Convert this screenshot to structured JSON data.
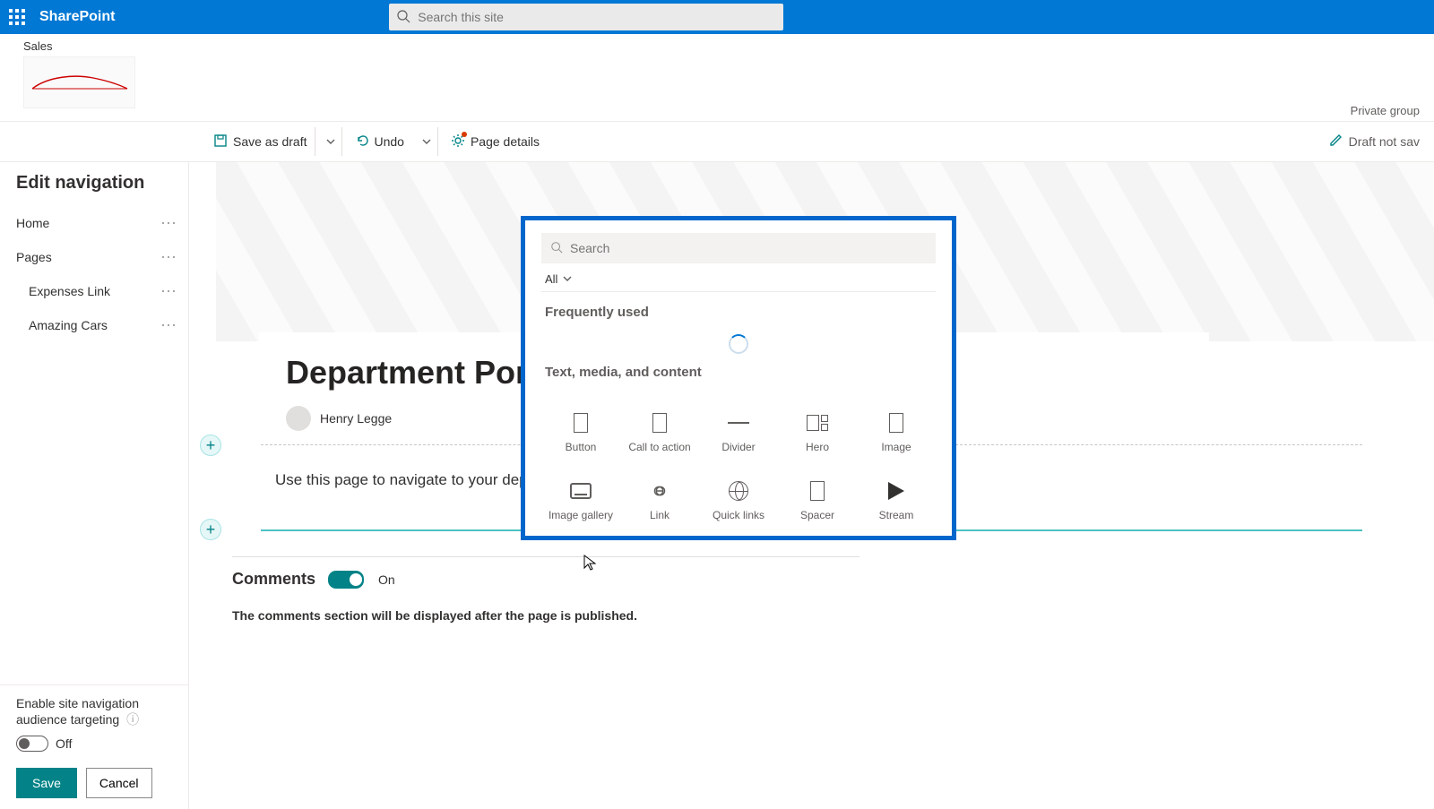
{
  "suite": {
    "brand": "SharePoint",
    "search_placeholder": "Search this site"
  },
  "site": {
    "title": "Sales",
    "privacy": "Private group"
  },
  "commands": {
    "save_draft": "Save as draft",
    "undo": "Undo",
    "page_details": "Page details",
    "draft_status": "Draft not sav"
  },
  "nav": {
    "title": "Edit navigation",
    "items": [
      {
        "label": "Home",
        "sub": false
      },
      {
        "label": "Pages",
        "sub": false
      },
      {
        "label": "Expenses Link",
        "sub": true
      },
      {
        "label": "Amazing Cars",
        "sub": true
      }
    ],
    "targeting_label": "Enable site navigation audience targeting",
    "targeting_state": "Off",
    "save": "Save",
    "cancel": "Cancel"
  },
  "page": {
    "title": "Department Portals",
    "author": "Henry Legge",
    "intro": "Use this page to navigate to your department portals"
  },
  "comments": {
    "label": "Comments",
    "state": "On",
    "note": "The comments section will be displayed after the page is published."
  },
  "picker": {
    "search_placeholder": "Search",
    "filter": "All",
    "section_freq": "Frequently used",
    "section_text": "Text, media, and content",
    "items1": [
      {
        "label": "Button",
        "icon": "box"
      },
      {
        "label": "Call to action",
        "icon": "box"
      },
      {
        "label": "Divider",
        "icon": "hline"
      },
      {
        "label": "Hero",
        "icon": "hero"
      },
      {
        "label": "Image",
        "icon": "box"
      }
    ],
    "items2": [
      {
        "label": "Image gallery",
        "icon": "gallery"
      },
      {
        "label": "Link",
        "icon": "link"
      },
      {
        "label": "Quick links",
        "icon": "globe"
      },
      {
        "label": "Spacer",
        "icon": "box"
      },
      {
        "label": "Stream",
        "icon": "play"
      }
    ]
  }
}
